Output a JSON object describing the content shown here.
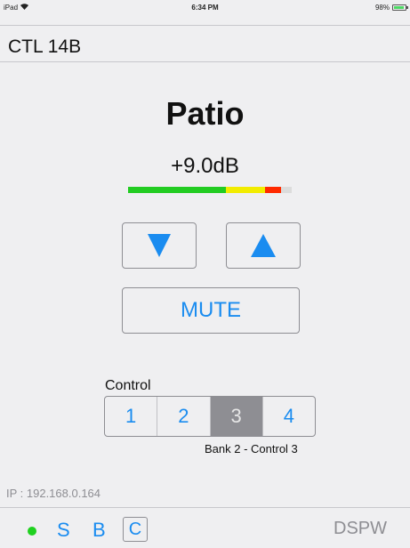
{
  "status_bar": {
    "device": "iPad",
    "time": "6:34 PM",
    "battery": "98%"
  },
  "header": {
    "title": "CTL 14B"
  },
  "zone": {
    "name": "Patio",
    "level": "+9.0dB"
  },
  "meter": {
    "segments": [
      {
        "color": "#22cc22",
        "fraction": 0.6
      },
      {
        "color": "#f2ec00",
        "fraction": 0.24
      },
      {
        "color": "#ff2a00",
        "fraction": 0.1
      }
    ]
  },
  "volume_controls": {
    "mute_label": "MUTE"
  },
  "control": {
    "label": "Control",
    "options": [
      "1",
      "2",
      "3",
      "4"
    ],
    "selected": "3",
    "bank_text": "Bank 2 - Control 3"
  },
  "ip_text": "IP : 192.168.0.164",
  "footer": {
    "status_color": "#1fd11f",
    "s_label": "S",
    "b_label": "B",
    "c_label": "C",
    "brand": "DSPW"
  },
  "colors": {
    "accent": "#1a8cf0",
    "selected_bg": "#8e8e93"
  }
}
